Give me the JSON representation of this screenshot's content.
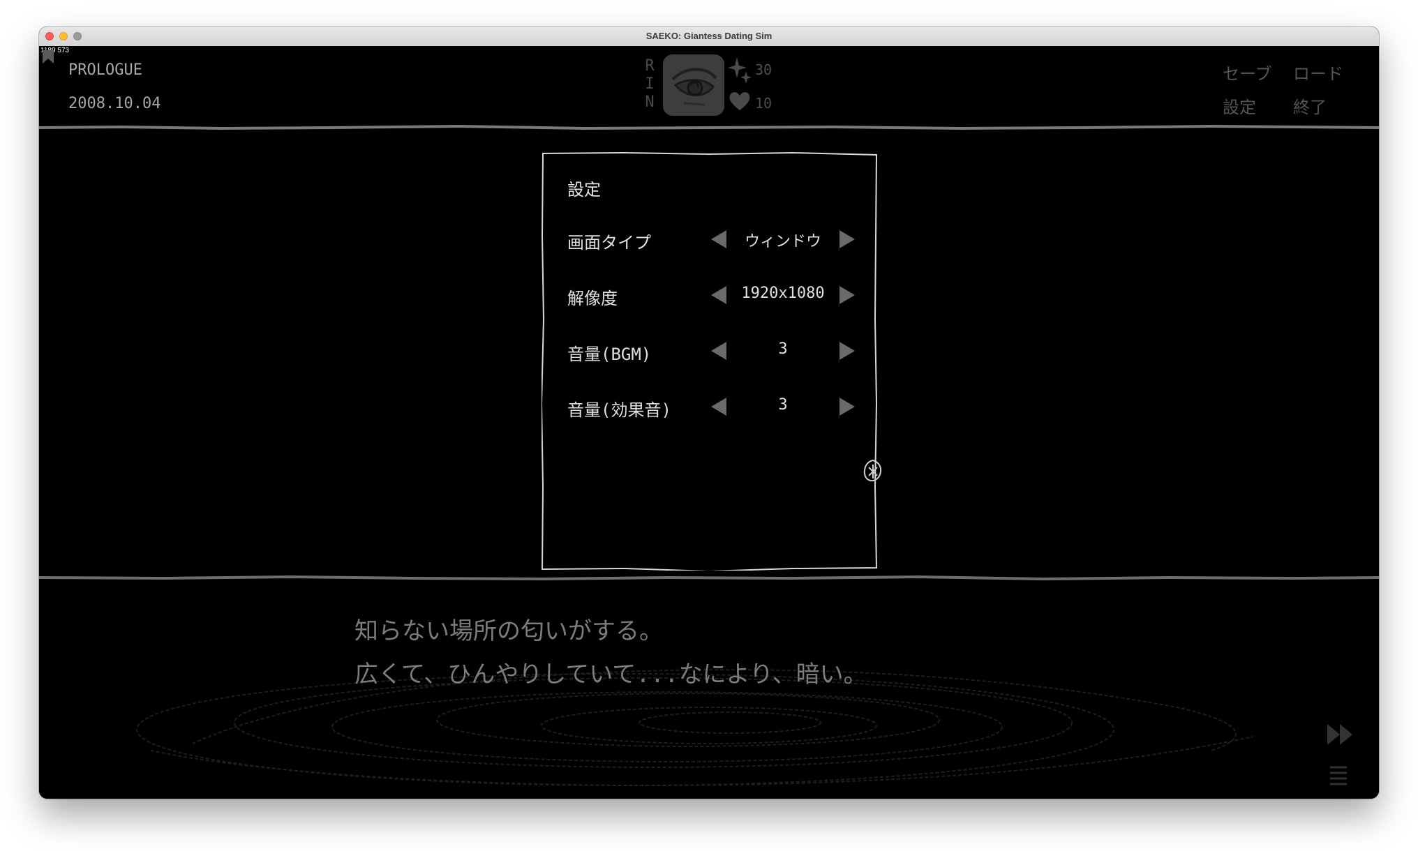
{
  "window": {
    "title": "SAEKO: Giantess Dating Sim"
  },
  "debug": {
    "coords": "1189 573"
  },
  "header": {
    "chapter": "PROLOGUE",
    "date": "2008.10.04",
    "character_name_letters": [
      "R",
      "I",
      "N"
    ],
    "stats": [
      {
        "icon": "sparkle-icon",
        "value": "30"
      },
      {
        "icon": "heart-icon",
        "value": "10"
      }
    ],
    "menu": {
      "save": "セーブ",
      "load": "ロード",
      "settings": "設定",
      "quit": "終了"
    }
  },
  "settings_panel": {
    "title": "設定",
    "rows": [
      {
        "label": "画面タイプ",
        "value": "ウィンドウ"
      },
      {
        "label": "解像度",
        "value": "1920x1080"
      },
      {
        "label": "音量(BGM)",
        "value": "3"
      },
      {
        "label": "音量(効果音)",
        "value": "3"
      }
    ]
  },
  "dialogue": {
    "lines": [
      "知らない場所の匂いがする。",
      "広くて、ひんやりしていて...なにより、暗い。"
    ]
  },
  "controls": {
    "skip": "skip-forward-icon",
    "log": "log-list-icon"
  },
  "colors": {
    "background": "#000000",
    "text_bright": "#e0e0e0",
    "text_dim": "#a9a9a9",
    "text_muted": "#545454"
  }
}
